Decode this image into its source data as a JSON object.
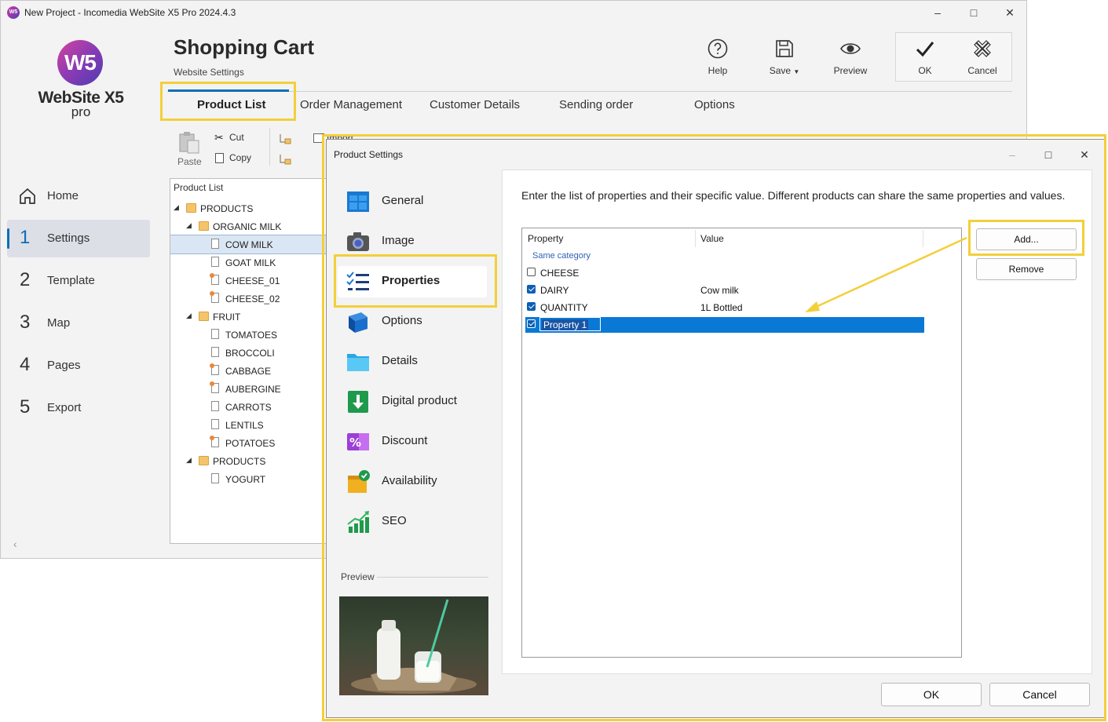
{
  "window": {
    "title": "New Project - Incomedia WebSite X5 Pro 2024.4.3"
  },
  "logo": {
    "mark": "W5",
    "name": "WebSite X5",
    "edition": "pro"
  },
  "header": {
    "title": "Shopping Cart",
    "subtitle": "Website Settings"
  },
  "toolbar": {
    "help": "Help",
    "save": "Save",
    "preview": "Preview",
    "ok": "OK",
    "cancel": "Cancel"
  },
  "tabs": [
    "Product List",
    "Order Management",
    "Customer Details",
    "Sending order",
    "Options"
  ],
  "sidebar": [
    {
      "num": "",
      "label": "Home"
    },
    {
      "num": "1",
      "label": "Settings"
    },
    {
      "num": "2",
      "label": "Template"
    },
    {
      "num": "3",
      "label": "Map"
    },
    {
      "num": "4",
      "label": "Pages"
    },
    {
      "num": "5",
      "label": "Export"
    }
  ],
  "edit_toolbar": {
    "paste": "Paste",
    "cut": "Cut",
    "copy": "Copy",
    "import": "Import"
  },
  "tree": {
    "header": "Product List",
    "rows": [
      {
        "level": 0,
        "type": "folder",
        "label": "PRODUCTS"
      },
      {
        "level": 1,
        "type": "folder",
        "label": "ORGANIC MILK"
      },
      {
        "level": 2,
        "type": "doc",
        "label": "COW MILK"
      },
      {
        "level": 2,
        "type": "doc",
        "label": "GOAT MILK"
      },
      {
        "level": 2,
        "type": "docstar",
        "label": "CHEESE_01"
      },
      {
        "level": 2,
        "type": "docstar",
        "label": "CHEESE_02"
      },
      {
        "level": 1,
        "type": "folder",
        "label": "FRUIT"
      },
      {
        "level": 2,
        "type": "doc",
        "label": "TOMATOES"
      },
      {
        "level": 2,
        "type": "doc",
        "label": "BROCCOLI"
      },
      {
        "level": 2,
        "type": "docstar",
        "label": "CABBAGE"
      },
      {
        "level": 2,
        "type": "docstar",
        "label": "AUBERGINE"
      },
      {
        "level": 2,
        "type": "doc",
        "label": "CARROTS"
      },
      {
        "level": 2,
        "type": "doc",
        "label": "LENTILS"
      },
      {
        "level": 2,
        "type": "docstar",
        "label": "POTATOES"
      },
      {
        "level": 1,
        "type": "folder",
        "label": "PRODUCTS"
      },
      {
        "level": 2,
        "type": "doc",
        "label": "YOGURT"
      }
    ]
  },
  "dialog": {
    "title": "Product Settings",
    "categories": [
      "General",
      "Image",
      "Properties",
      "Options",
      "Details",
      "Digital product",
      "Discount",
      "Availability",
      "SEO"
    ],
    "preview_label": "Preview",
    "description": "Enter the list of properties and their specific value. Different products can share the same properties and values.",
    "grid": {
      "col_property": "Property",
      "col_value": "Value",
      "group_label": "Same category",
      "rows": [
        {
          "property": "CHEESE",
          "value": "",
          "checked": false
        },
        {
          "property": "DAIRY",
          "value": "Cow milk",
          "checked": true
        },
        {
          "property": "QUANTITY",
          "value": "1L Bottled",
          "checked": true
        },
        {
          "property": "Property 1",
          "value": "",
          "checked": true
        }
      ]
    },
    "add_button": "Add...",
    "remove_button": "Remove",
    "ok_button": "OK",
    "cancel_button": "Cancel"
  },
  "colors": {
    "accent": "#0e6eb6",
    "highlight": "#f3cf3a",
    "selection": "#0a79d6"
  }
}
